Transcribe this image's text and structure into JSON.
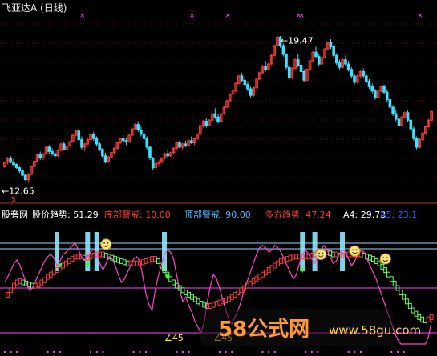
{
  "title": "飞亚达A (日线)",
  "chart_data": [
    {
      "type": "candlestick",
      "title": "飞亚达A (日线)",
      "max_label": "19.47",
      "min_label": "12.65",
      "ylim": [
        12.3,
        20.3
      ],
      "colors": {
        "up": "#ff3b3b",
        "down": "#3fe0ff",
        "marker": "#ff44ff"
      },
      "top_markers": [
        26,
        63,
        75,
        99,
        100,
        140,
        178,
        205,
        206,
        207,
        208,
        218,
        219,
        229
      ],
      "ohlc": [
        [
          13.4,
          13.65,
          13.35,
          13.6
        ],
        [
          13.6,
          13.85,
          13.5,
          13.8
        ],
        [
          13.8,
          13.9,
          13.55,
          13.6
        ],
        [
          13.6,
          13.75,
          13.4,
          13.5
        ],
        [
          13.5,
          13.55,
          13.3,
          13.35
        ],
        [
          13.35,
          13.4,
          13.1,
          13.2
        ],
        [
          13.2,
          13.25,
          12.95,
          13.0
        ],
        [
          13.0,
          13.05,
          12.75,
          12.8
        ],
        [
          12.8,
          13.1,
          12.65,
          13.05
        ],
        [
          13.05,
          13.45,
          13.0,
          13.4
        ],
        [
          13.4,
          13.7,
          13.35,
          13.65
        ],
        [
          13.65,
          14.0,
          13.6,
          13.95
        ],
        [
          13.95,
          14.1,
          13.7,
          13.8
        ],
        [
          13.8,
          14.05,
          13.7,
          14.0
        ],
        [
          14.0,
          14.35,
          13.95,
          14.3
        ],
        [
          14.3,
          14.4,
          14.0,
          14.1
        ],
        [
          14.1,
          14.25,
          13.9,
          14.0
        ],
        [
          14.0,
          14.15,
          13.8,
          13.9
        ],
        [
          13.9,
          14.2,
          13.85,
          14.15
        ],
        [
          14.15,
          14.5,
          14.1,
          14.45
        ],
        [
          14.45,
          14.55,
          14.15,
          14.2
        ],
        [
          14.2,
          14.4,
          14.05,
          14.35
        ],
        [
          14.35,
          14.6,
          14.3,
          14.55
        ],
        [
          14.55,
          14.9,
          14.5,
          14.85
        ],
        [
          14.85,
          15.1,
          14.8,
          15.05
        ],
        [
          15.05,
          15.15,
          14.6,
          14.65
        ],
        [
          14.65,
          14.8,
          14.2,
          14.3
        ],
        [
          14.3,
          14.5,
          14.1,
          14.45
        ],
        [
          14.45,
          14.7,
          14.4,
          14.65
        ],
        [
          14.65,
          14.95,
          14.6,
          14.9
        ],
        [
          14.9,
          15.0,
          14.6,
          14.7
        ],
        [
          14.7,
          14.8,
          14.35,
          14.45
        ],
        [
          14.45,
          14.55,
          14.1,
          14.2
        ],
        [
          14.2,
          14.25,
          13.8,
          13.9
        ],
        [
          13.9,
          14.05,
          13.55,
          13.65
        ],
        [
          13.65,
          13.9,
          13.6,
          13.85
        ],
        [
          13.85,
          14.1,
          13.8,
          14.05
        ],
        [
          14.05,
          14.3,
          14.0,
          14.25
        ],
        [
          14.25,
          14.55,
          14.2,
          14.5
        ],
        [
          14.5,
          14.75,
          14.45,
          14.7
        ],
        [
          14.7,
          14.85,
          14.5,
          14.6
        ],
        [
          14.6,
          14.75,
          14.4,
          14.55
        ],
        [
          14.55,
          14.9,
          14.5,
          14.85
        ],
        [
          14.85,
          15.2,
          14.8,
          15.15
        ],
        [
          15.15,
          15.4,
          15.1,
          15.35
        ],
        [
          15.35,
          15.5,
          15.0,
          15.1
        ],
        [
          15.1,
          15.25,
          14.8,
          14.9
        ],
        [
          14.9,
          15.05,
          14.6,
          14.7
        ],
        [
          14.7,
          14.8,
          14.2,
          14.3
        ],
        [
          14.3,
          14.35,
          13.7,
          13.8
        ],
        [
          13.8,
          13.85,
          13.25,
          13.35
        ],
        [
          13.35,
          13.6,
          13.2,
          13.55
        ],
        [
          13.55,
          13.7,
          13.45,
          13.6
        ],
        [
          13.6,
          13.85,
          13.55,
          13.8
        ],
        [
          13.8,
          14.05,
          13.75,
          14.0
        ],
        [
          14.0,
          14.2,
          13.8,
          13.9
        ],
        [
          13.9,
          14.1,
          13.85,
          14.05
        ],
        [
          14.05,
          14.3,
          14.0,
          14.25
        ],
        [
          14.25,
          14.55,
          14.2,
          14.5
        ],
        [
          14.5,
          14.6,
          14.25,
          14.3
        ],
        [
          14.3,
          14.5,
          14.2,
          14.45
        ],
        [
          14.45,
          14.6,
          14.3,
          14.4
        ],
        [
          14.4,
          14.65,
          14.35,
          14.6
        ],
        [
          14.6,
          14.8,
          14.45,
          14.5
        ],
        [
          14.5,
          14.75,
          14.4,
          14.7
        ],
        [
          14.7,
          14.95,
          14.65,
          14.9
        ],
        [
          14.9,
          15.35,
          14.85,
          15.3
        ],
        [
          15.3,
          15.55,
          15.2,
          15.5
        ],
        [
          15.5,
          15.65,
          15.2,
          15.3
        ],
        [
          15.3,
          15.6,
          15.25,
          15.55
        ],
        [
          15.55,
          15.9,
          15.5,
          15.85
        ],
        [
          15.85,
          16.1,
          15.6,
          15.7
        ],
        [
          15.7,
          15.85,
          15.4,
          15.5
        ],
        [
          15.5,
          15.9,
          15.45,
          15.85
        ],
        [
          15.85,
          16.2,
          15.8,
          16.15
        ],
        [
          16.15,
          16.5,
          16.1,
          16.45
        ],
        [
          16.45,
          16.8,
          16.4,
          16.75
        ],
        [
          16.75,
          17.0,
          16.6,
          16.9
        ],
        [
          16.9,
          17.3,
          16.85,
          17.25
        ],
        [
          17.25,
          17.65,
          17.2,
          17.6
        ],
        [
          17.6,
          17.75,
          17.3,
          17.4
        ],
        [
          17.4,
          17.55,
          17.1,
          17.2
        ],
        [
          17.2,
          17.35,
          16.9,
          17.0
        ],
        [
          17.0,
          17.1,
          16.6,
          16.7
        ],
        [
          16.7,
          17.1,
          16.65,
          17.05
        ],
        [
          17.05,
          17.5,
          17.0,
          17.45
        ],
        [
          17.45,
          17.8,
          17.4,
          17.75
        ],
        [
          17.75,
          18.1,
          17.7,
          18.05
        ],
        [
          18.05,
          18.3,
          17.8,
          17.9
        ],
        [
          17.9,
          18.2,
          17.85,
          18.15
        ],
        [
          18.15,
          18.6,
          18.1,
          18.55
        ],
        [
          18.55,
          19.05,
          18.5,
          19.0
        ],
        [
          19.0,
          19.47,
          18.95,
          19.4
        ],
        [
          19.4,
          19.45,
          18.9,
          19.0
        ],
        [
          19.0,
          19.1,
          18.5,
          18.6
        ],
        [
          18.6,
          18.65,
          17.9,
          18.0
        ],
        [
          18.0,
          18.1,
          17.4,
          17.5
        ],
        [
          17.5,
          18.0,
          17.45,
          17.95
        ],
        [
          17.95,
          18.4,
          17.9,
          18.35
        ],
        [
          18.35,
          18.6,
          18.0,
          18.1
        ],
        [
          18.1,
          18.3,
          17.7,
          17.8
        ],
        [
          17.8,
          17.9,
          17.3,
          17.4
        ],
        [
          17.4,
          17.95,
          17.35,
          17.9
        ],
        [
          17.9,
          18.35,
          17.85,
          18.3
        ],
        [
          18.3,
          18.75,
          18.25,
          18.7
        ],
        [
          18.7,
          18.95,
          18.4,
          18.5
        ],
        [
          18.5,
          18.6,
          18.05,
          18.15
        ],
        [
          18.15,
          18.5,
          18.1,
          18.45
        ],
        [
          18.45,
          18.9,
          18.4,
          18.85
        ],
        [
          18.85,
          19.2,
          18.8,
          19.15
        ],
        [
          19.15,
          19.3,
          18.85,
          18.95
        ],
        [
          18.95,
          19.0,
          18.45,
          18.55
        ],
        [
          18.55,
          18.65,
          18.1,
          18.2
        ],
        [
          18.2,
          18.35,
          17.9,
          18.0
        ],
        [
          18.0,
          18.4,
          17.95,
          18.35
        ],
        [
          18.35,
          18.55,
          18.05,
          18.15
        ],
        [
          18.15,
          18.3,
          17.8,
          17.9
        ],
        [
          17.9,
          18.0,
          17.5,
          17.6
        ],
        [
          17.6,
          17.7,
          17.2,
          17.3
        ],
        [
          17.3,
          17.65,
          17.25,
          17.6
        ],
        [
          17.6,
          17.85,
          17.5,
          17.8
        ],
        [
          17.8,
          17.95,
          17.5,
          17.6
        ],
        [
          17.6,
          17.7,
          17.25,
          17.35
        ],
        [
          17.35,
          17.45,
          17.0,
          17.1
        ],
        [
          17.1,
          17.25,
          16.8,
          16.9
        ],
        [
          16.9,
          17.0,
          16.5,
          16.6
        ],
        [
          16.6,
          16.95,
          16.55,
          16.9
        ],
        [
          16.9,
          17.15,
          16.85,
          17.1
        ],
        [
          17.1,
          17.2,
          16.75,
          16.85
        ],
        [
          16.85,
          16.95,
          16.4,
          16.5
        ],
        [
          16.5,
          16.6,
          16.05,
          16.15
        ],
        [
          16.15,
          16.25,
          15.75,
          15.85
        ],
        [
          15.85,
          16.0,
          15.5,
          15.6
        ],
        [
          15.6,
          15.7,
          15.2,
          15.3
        ],
        [
          15.3,
          15.75,
          15.25,
          15.7
        ],
        [
          15.7,
          15.95,
          15.65,
          15.9
        ],
        [
          15.9,
          16.0,
          15.45,
          15.55
        ],
        [
          15.55,
          15.65,
          15.05,
          15.15
        ],
        [
          15.15,
          15.25,
          14.6,
          14.7
        ],
        [
          14.7,
          14.8,
          14.2,
          14.3
        ],
        [
          14.3,
          14.7,
          14.25,
          14.65
        ],
        [
          14.65,
          15.0,
          14.6,
          14.95
        ],
        [
          14.95,
          15.3,
          14.9,
          15.25
        ],
        [
          15.25,
          15.6,
          15.2,
          15.55
        ],
        [
          15.55,
          16.0,
          15.5,
          15.95
        ]
      ]
    },
    {
      "type": "line",
      "title": "股价趋势",
      "legend": [
        {
          "name": "股价趋势",
          "value": "51.29",
          "color": "#ffffff"
        },
        {
          "name": "底部警戒",
          "value": "10.00",
          "color": "#ff3b3b"
        },
        {
          "name": "顶部警戒",
          "value": "90.00",
          "color": "#4fb8ff"
        },
        {
          "name": "多方趋势",
          "value": "47.24",
          "color": "#ff3b3b"
        },
        {
          "name": "A4",
          "value": "29.73",
          "color": "#ffffff"
        },
        {
          "name": "A5",
          "value": "23.1",
          "color": "#3366ff"
        }
      ],
      "ylim": [
        0,
        100
      ],
      "levels": [
        {
          "name": "顶部警戒",
          "value": 90,
          "color": "#9fd0ff"
        },
        {
          "name": "",
          "value": 85,
          "color": "#9fd0ff"
        },
        {
          "name": "",
          "value": 50,
          "color": "#ff44ff"
        },
        {
          "name": "底部警戒",
          "value": 10,
          "color": "#ff44ff"
        }
      ],
      "cyan_bar_positions": [
        17,
        27,
        30,
        52,
        97,
        101,
        110
      ],
      "smiley_positions": [
        [
          33,
          89
        ],
        [
          103,
          80
        ],
        [
          114,
          83
        ],
        [
          124,
          76
        ]
      ],
      "down_arrow_positions": [
        [
          18,
          72
        ],
        [
          27,
          72
        ],
        [
          53,
          62
        ],
        [
          97,
          68
        ]
      ],
      "bottom_labels": [
        "∠45",
        "∠45"
      ],
      "bottom_label_positions": [
        52,
        68
      ],
      "series": [
        {
          "name": "股价趋势",
          "color": "#ff44cc",
          "values": [
            55,
            60,
            66,
            72,
            75,
            70,
            62,
            55,
            48,
            50,
            56,
            62,
            68,
            74,
            78,
            80,
            77,
            70,
            74,
            80,
            82,
            85,
            88,
            90,
            84,
            78,
            75,
            78,
            82,
            85,
            80,
            72,
            66,
            72,
            78,
            76,
            70,
            62,
            55,
            58,
            64,
            70,
            76,
            78,
            74,
            60,
            45,
            35,
            30,
            48,
            60,
            70,
            80,
            84,
            82,
            76,
            62,
            48,
            38,
            42,
            34,
            28,
            20,
            15,
            10,
            20,
            38,
            52,
            62,
            58,
            50,
            40,
            30,
            22,
            18,
            24,
            30,
            38,
            48,
            56,
            64,
            72,
            80,
            86,
            88,
            86,
            82,
            84,
            88,
            86,
            82,
            76,
            70,
            64,
            58,
            62,
            72,
            80,
            84,
            80,
            76,
            72,
            78,
            84,
            88,
            84,
            78,
            72,
            74,
            80,
            84,
            82,
            76,
            70,
            74,
            80,
            84,
            82,
            76,
            70,
            64,
            58,
            50,
            42,
            34,
            26,
            18,
            10,
            4,
            0,
            0,
            0,
            0,
            0,
            0,
            0,
            0,
            0,
            6,
            20
          ]
        },
        {
          "name": "多方趋势",
          "color": "#ff3b3b",
          "values": [
            40,
            44,
            48,
            52,
            55,
            56,
            55,
            54,
            53,
            52,
            52,
            53,
            55,
            57,
            60,
            62,
            64,
            66,
            68,
            70,
            72,
            74,
            76,
            78,
            78,
            78,
            77,
            77,
            78,
            79,
            80,
            80,
            80,
            79,
            78,
            77,
            76,
            75,
            74,
            73,
            72,
            72,
            72,
            72,
            72,
            73,
            74,
            75,
            76,
            76,
            74,
            70,
            66,
            62,
            58,
            55,
            52,
            50,
            48,
            46,
            44,
            42,
            40,
            38,
            36,
            35,
            34,
            34,
            35,
            36,
            37,
            38,
            39,
            40,
            42,
            44,
            46,
            48,
            50,
            52,
            54,
            56,
            58,
            60,
            62,
            64,
            66,
            68,
            70,
            72,
            74,
            75,
            76,
            77,
            78,
            78,
            78,
            78,
            78,
            78,
            79,
            80,
            81,
            82,
            82,
            82,
            81,
            80,
            80,
            79,
            79,
            79,
            80,
            80,
            80,
            80,
            80,
            79,
            78,
            77,
            76,
            74,
            72,
            69,
            66,
            62,
            58,
            54,
            50,
            46,
            42,
            38,
            34,
            30,
            27,
            24,
            22,
            21,
            22,
            24
          ]
        }
      ]
    }
  ],
  "watermark": {
    "title": "58公式网",
    "url": "www.58gu.com"
  }
}
